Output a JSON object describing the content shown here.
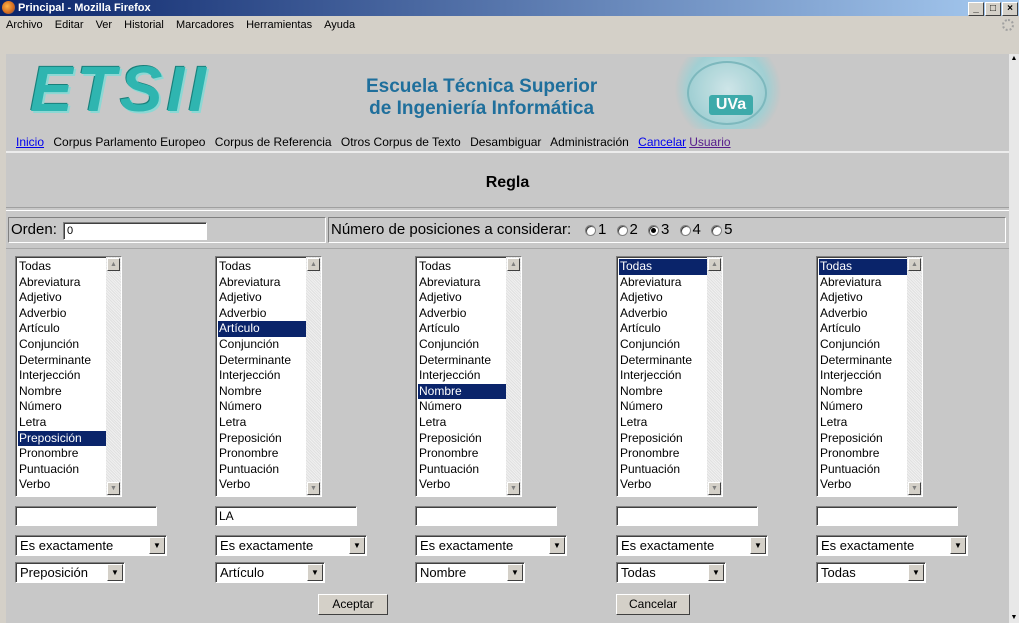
{
  "window": {
    "title": "Principal - Mozilla Firefox"
  },
  "menu": [
    "Archivo",
    "Editar",
    "Ver",
    "Historial",
    "Marcadores",
    "Herramientas",
    "Ayuda"
  ],
  "banner": {
    "logo_text": "ETSII",
    "school_line1": "Escuela Técnica Superior",
    "school_line2": "de Ingeniería Informática",
    "uva": "UVa"
  },
  "nav": {
    "inicio": "Inicio",
    "corpus_parlamento": "Corpus Parlamento Europeo",
    "corpus_referencia": "Corpus de Referencia",
    "otros_corpus": "Otros Corpus de Texto",
    "desambiguar": "Desambiguar",
    "administracion": "Administración",
    "cancelar": "Cancelar",
    "usuario": "Usuario"
  },
  "page": {
    "heading": "Regla"
  },
  "orden": {
    "label": "Orden:",
    "value": "0"
  },
  "posiciones": {
    "label": "Número de posiciones a considerar:",
    "options": [
      "1",
      "2",
      "3",
      "4",
      "5"
    ],
    "selected": "3"
  },
  "categories": [
    "Todas",
    "Abreviatura",
    "Adjetivo",
    "Adverbio",
    "Artículo",
    "Conjunción",
    "Determinante",
    "Interjección",
    "Nombre",
    "Número",
    "Letra",
    "Preposición",
    "Pronombre",
    "Puntuación",
    "Verbo"
  ],
  "columns": [
    {
      "selected_index": 11,
      "text": "",
      "condition": "Es exactamente",
      "category": "Preposición"
    },
    {
      "selected_index": 4,
      "text": "LA",
      "condition": "Es exactamente",
      "category": "Artículo"
    },
    {
      "selected_index": 8,
      "text": "",
      "condition": "Es exactamente",
      "category": "Nombre"
    },
    {
      "selected_index": 0,
      "text": "",
      "condition": "Es exactamente",
      "category": "Todas"
    },
    {
      "selected_index": 0,
      "text": "",
      "condition": "Es exactamente",
      "category": "Todas"
    }
  ],
  "buttons": {
    "aceptar": "Aceptar",
    "cancelar": "Cancelar"
  }
}
